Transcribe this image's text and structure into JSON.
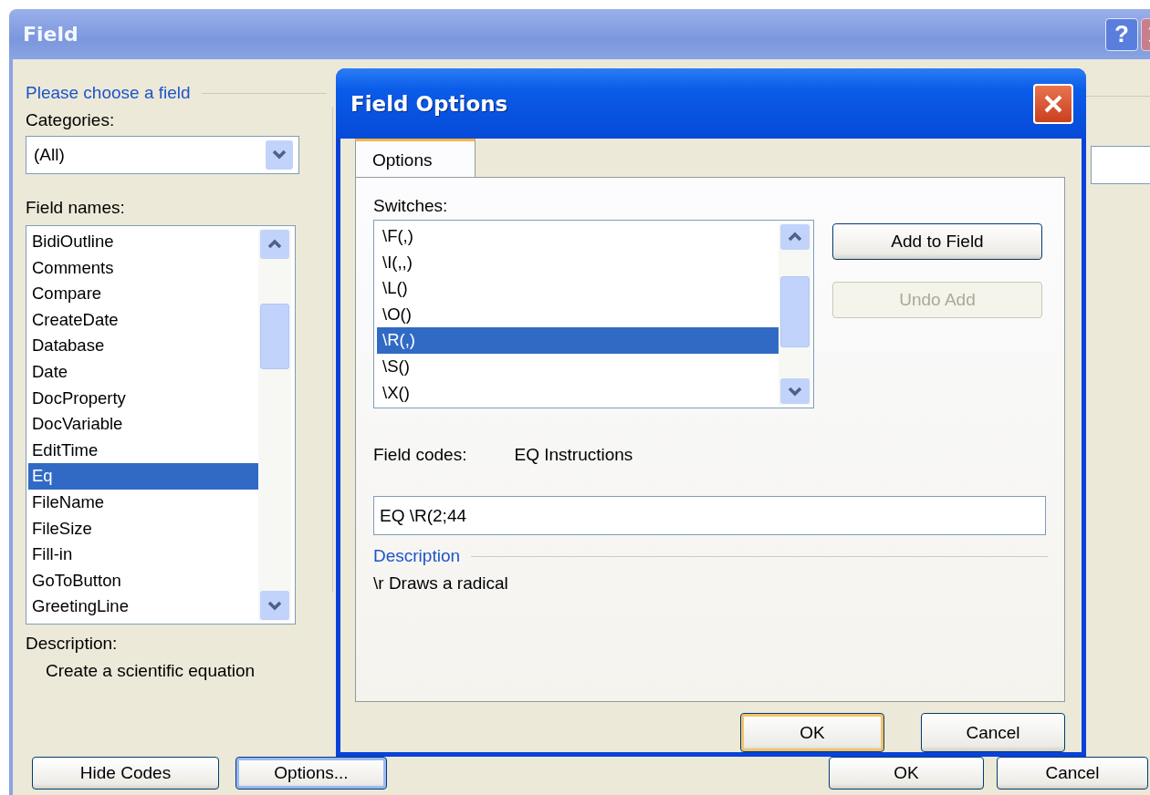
{
  "window": {
    "title": "Field",
    "help_button": "?"
  },
  "choose_group": {
    "heading": "Please choose a field",
    "categories_label": "Categories:",
    "categories_value": "(All)",
    "field_names_label": "Field names:",
    "field_names": [
      {
        "label": "BidiOutline",
        "selected": false
      },
      {
        "label": "Comments",
        "selected": false
      },
      {
        "label": "Compare",
        "selected": false
      },
      {
        "label": "CreateDate",
        "selected": false
      },
      {
        "label": "Database",
        "selected": false
      },
      {
        "label": "Date",
        "selected": false
      },
      {
        "label": "DocProperty",
        "selected": false
      },
      {
        "label": "DocVariable",
        "selected": false
      },
      {
        "label": "EditTime",
        "selected": false
      },
      {
        "label": "Eq",
        "selected": true
      },
      {
        "label": "FileName",
        "selected": false
      },
      {
        "label": "FileSize",
        "selected": false
      },
      {
        "label": "Fill-in",
        "selected": false
      },
      {
        "label": "GoToButton",
        "selected": false
      },
      {
        "label": "GreetingLine",
        "selected": false
      }
    ],
    "description_label": "Description:",
    "description": "Create a scientific equation"
  },
  "buttons": [
    {
      "label": "Hide Codes",
      "focused": false
    },
    {
      "label": "Options...",
      "focused": true
    },
    {
      "label": "OK",
      "focused": false
    },
    {
      "label": "Cancel",
      "focused": false
    }
  ],
  "options_dialog": {
    "title": "Field Options",
    "tabs": [
      {
        "label": "Options",
        "selected": true
      }
    ],
    "switches_label": "Switches:",
    "switches": [
      {
        "label": "\\F(,)",
        "selected": false
      },
      {
        "label": "\\I(,,)",
        "selected": false
      },
      {
        "label": "\\L()",
        "selected": false
      },
      {
        "label": "\\O()",
        "selected": false
      },
      {
        "label": "\\R(,)",
        "selected": true
      },
      {
        "label": "\\S()",
        "selected": false
      },
      {
        "label": "\\X()",
        "selected": false
      }
    ],
    "actions": [
      {
        "label": "Add to Field",
        "disabled": false
      },
      {
        "label": "Undo Add",
        "disabled": true
      }
    ],
    "field_codes_label": "Field codes:",
    "field_codes_hint": "EQ Instructions",
    "field_code": "EQ \\R(2;44",
    "description_heading": "Description",
    "description": "\\r Draws a radical",
    "buttons": [
      {
        "label": "OK",
        "default": true
      },
      {
        "label": "Cancel",
        "default": false
      }
    ]
  }
}
